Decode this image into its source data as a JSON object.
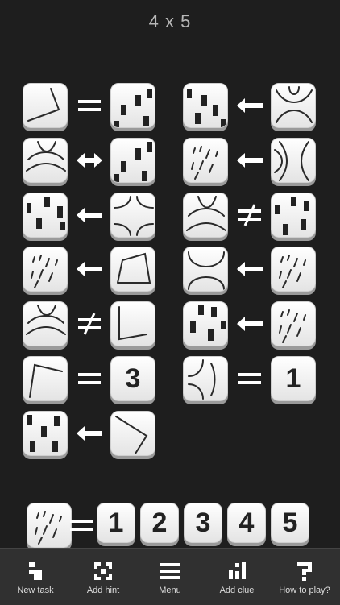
{
  "header": {
    "title": "4 x 5"
  },
  "clues": [
    {
      "left": "angle-a",
      "op": "equals",
      "right": "blocks-a"
    },
    {
      "left": "blocks-b",
      "op": "left-arrow",
      "right": "arcs-a"
    },
    {
      "left": "arcs-b",
      "op": "double-arrow",
      "right": "blocks-c"
    },
    {
      "left": "rain",
      "op": "left-arrow",
      "right": "arcs-c"
    },
    {
      "left": "blocks-d",
      "op": "left-arrow",
      "right": "arcs-d"
    },
    {
      "left": "arcs-e",
      "op": "not-equal",
      "right": "blocks-e"
    },
    {
      "left": "rain",
      "op": "left-arrow",
      "right": "angle-b"
    },
    {
      "left": "arcs-f",
      "op": "left-arrow",
      "right": "rain"
    },
    {
      "left": "arcs-b",
      "op": "not-equal",
      "right": "angle-c"
    },
    {
      "left": "blocks-f",
      "op": "left-arrow",
      "right": "rain"
    },
    {
      "left": "angle-d",
      "op": "equals",
      "right": "3"
    },
    {
      "left": "arcs-g",
      "op": "equals",
      "right": "1"
    },
    {
      "left": "blocks-g",
      "op": "left-arrow",
      "right": "angle-e"
    }
  ],
  "answer": {
    "tile": "rain",
    "op": "equals",
    "options": [
      "1",
      "2",
      "3",
      "4",
      "5"
    ]
  },
  "toolbar": {
    "items": [
      {
        "label": "New task",
        "icon": "new-task-icon"
      },
      {
        "label": "Add hint",
        "icon": "add-hint-icon"
      },
      {
        "label": "Menu",
        "icon": "menu-icon"
      },
      {
        "label": "Add clue",
        "icon": "add-clue-icon"
      },
      {
        "label": "How to play?",
        "icon": "how-to-play-icon"
      }
    ]
  },
  "colors": {
    "background": "#1e1e1e",
    "tile": "#f2f2f2",
    "toolbar": "#303030",
    "operator": "#ffffff"
  }
}
